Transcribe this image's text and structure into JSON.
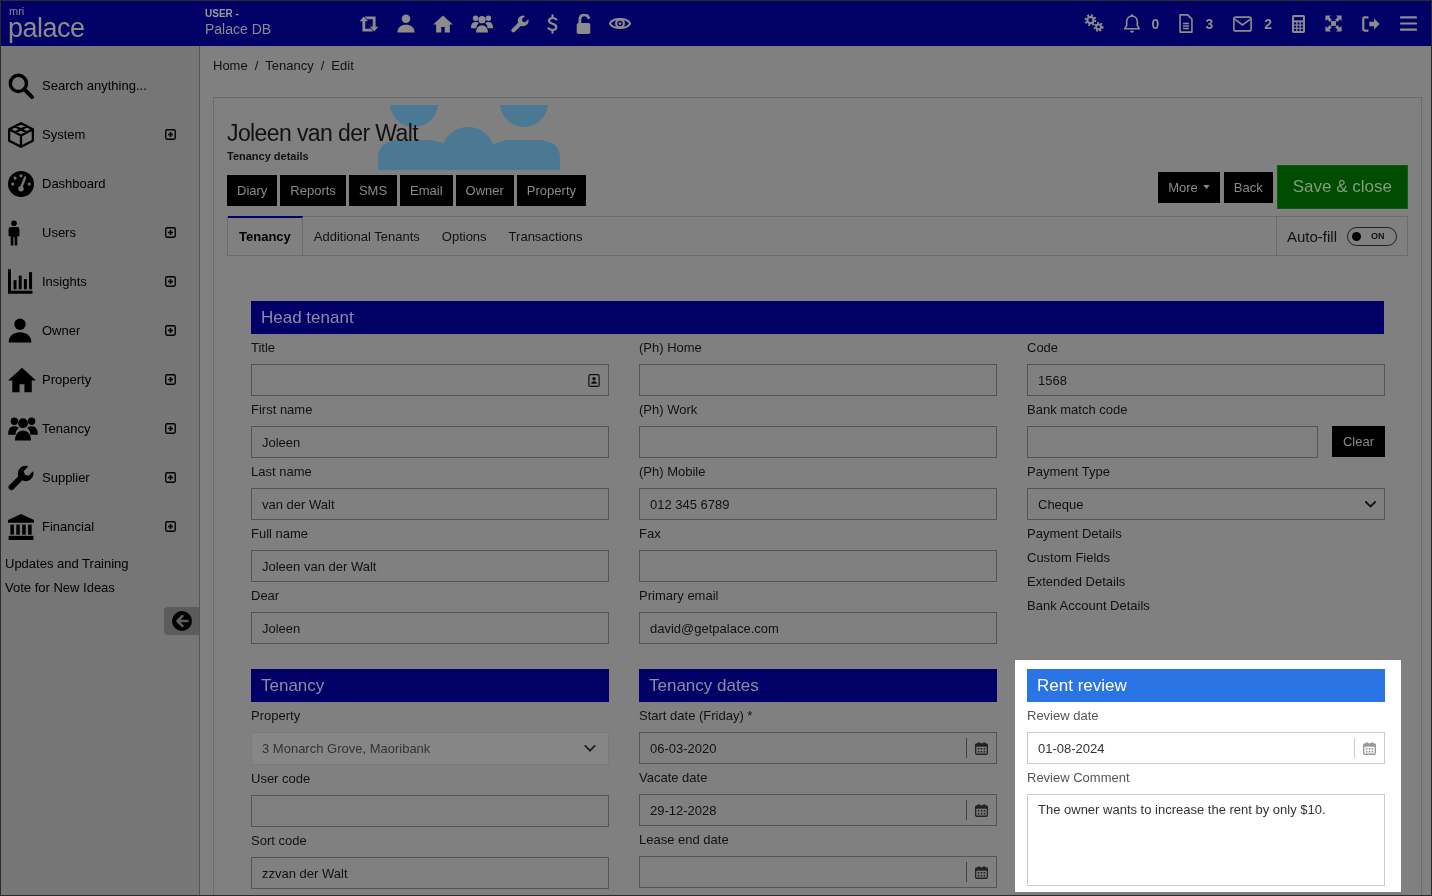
{
  "topbar": {
    "logo_small": "mri",
    "logo": "palace",
    "user_label": "USER -",
    "database": "Palace DB",
    "counters": [
      {
        "count": "0"
      },
      {
        "count": "3"
      },
      {
        "count": "2"
      }
    ]
  },
  "sidebar": {
    "search": "Search anything...",
    "items": [
      {
        "label": "System",
        "expandable": true
      },
      {
        "label": "Dashboard",
        "expandable": false
      },
      {
        "label": "Users",
        "expandable": true
      },
      {
        "label": "Insights",
        "expandable": true
      },
      {
        "label": "Owner",
        "expandable": true
      },
      {
        "label": "Property",
        "expandable": true
      },
      {
        "label": "Tenancy",
        "expandable": true
      },
      {
        "label": "Supplier",
        "expandable": true
      },
      {
        "label": "Financial",
        "expandable": true
      }
    ],
    "links": [
      "Updates and Training",
      "Vote for New Ideas"
    ]
  },
  "breadcrumb": {
    "items": [
      "Home",
      "Tenancy",
      "Edit"
    ],
    "separator": "/"
  },
  "header": {
    "title": "Joleen van der Walt",
    "subtitle": "Tenancy details",
    "quick_buttons": [
      "Diary",
      "Reports",
      "SMS",
      "Email",
      "Owner",
      "Property"
    ],
    "actions": [
      {
        "label": "More",
        "kind": "dropdown"
      },
      {
        "label": "Back",
        "kind": "plain"
      },
      {
        "label": "Save & close",
        "kind": "primary"
      }
    ]
  },
  "tabs": [
    {
      "label": "Tenancy",
      "selected": true
    },
    {
      "label": "Additional Tenants",
      "selected": false
    },
    {
      "label": "Options",
      "selected": false
    },
    {
      "label": "Transactions",
      "selected": false
    }
  ],
  "autofill": {
    "label": "Auto-fill",
    "state_text": "ON",
    "on": true
  },
  "head_tenant": {
    "title": "Head tenant",
    "highlighted": false,
    "columns": [
      [
        {
          "kind": "lookup",
          "label": "Title"
        },
        {
          "kind": "text",
          "label": "First name",
          "value": "Joleen"
        },
        {
          "kind": "text",
          "label": "Last name",
          "value": "van der Walt"
        },
        {
          "kind": "text",
          "label": "Full name",
          "value": "Joleen van der Walt"
        },
        {
          "kind": "text",
          "label": "Dear",
          "value": "Joleen"
        }
      ],
      [
        {
          "kind": "text",
          "label": "(Ph) Home"
        },
        {
          "kind": "text",
          "label": "(Ph) Work"
        },
        {
          "kind": "text",
          "label": "(Ph) Mobile",
          "value": "012 345 6789"
        },
        {
          "kind": "text",
          "label": "Fax"
        },
        {
          "kind": "text",
          "label": "Primary email",
          "value": "david@getpalace.com"
        }
      ],
      [
        {
          "kind": "text",
          "label": "Code",
          "value": "1568"
        },
        {
          "kind": "text_button",
          "label": "Bank match code",
          "button": "Clear"
        },
        {
          "kind": "select",
          "label": "Payment Type",
          "value": "Cheque",
          "disabled": false
        },
        {
          "kind": "link",
          "label": "Payment Details"
        },
        {
          "kind": "link",
          "label": "Custom Fields"
        },
        {
          "kind": "link",
          "label": "Extended Details"
        },
        {
          "kind": "link",
          "label": "Bank Account Details"
        }
      ]
    ]
  },
  "sections": [
    {
      "title": "Tenancy",
      "highlighted": false,
      "fields": [
        {
          "kind": "select",
          "label": "Property",
          "value": "3 Monarch Grove, Maoribank",
          "disabled": true
        },
        {
          "kind": "text",
          "label": "User code"
        },
        {
          "kind": "text",
          "label": "Sort code",
          "value": "zzvan der Walt"
        }
      ]
    },
    {
      "title": "Tenancy dates",
      "highlighted": false,
      "fields": [
        {
          "kind": "date",
          "label": "Start date (Friday) *",
          "value": "06-03-2020"
        },
        {
          "kind": "date",
          "label": "Vacate date",
          "value": "29-12-2028"
        },
        {
          "kind": "date",
          "label": "Lease end date"
        }
      ]
    },
    {
      "title": "Rent review",
      "highlighted": true,
      "fields": [
        {
          "kind": "date",
          "label": "Review date",
          "value": "01-08-2024"
        },
        {
          "kind": "textarea",
          "label": "Review Comment",
          "value": "The owner wants to increase the rent by only $10."
        }
      ]
    }
  ]
}
